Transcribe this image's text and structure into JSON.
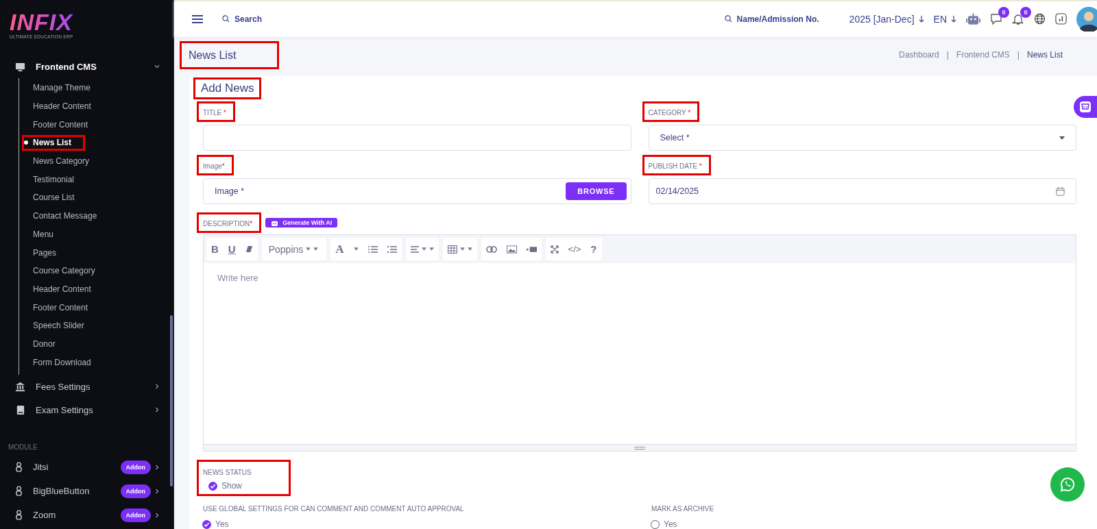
{
  "sidebar": {
    "logo": {
      "text": "INFIX",
      "tagline": "ULTIMATE EDUCATION ERP"
    },
    "menu": [
      {
        "label": "Frontend CMS",
        "expanded": true,
        "children": [
          {
            "label": "Manage Theme",
            "selected": false,
            "highlighted": false
          },
          {
            "label": "Header Content",
            "selected": false,
            "highlighted": false
          },
          {
            "label": "Footer Content",
            "selected": false,
            "highlighted": false
          },
          {
            "label": "News List",
            "selected": true,
            "highlighted": true
          },
          {
            "label": "News Category",
            "selected": false,
            "highlighted": false
          },
          {
            "label": "Testimonial",
            "selected": false,
            "highlighted": false
          },
          {
            "label": "Course List",
            "selected": false,
            "highlighted": false
          },
          {
            "label": "Contact Message",
            "selected": false,
            "highlighted": false
          },
          {
            "label": "Menu",
            "selected": false,
            "highlighted": false
          },
          {
            "label": "Pages",
            "selected": false,
            "highlighted": false
          },
          {
            "label": "Course Category",
            "selected": false,
            "highlighted": false
          },
          {
            "label": "Header Content",
            "selected": false,
            "highlighted": false
          },
          {
            "label": "Footer Content",
            "selected": false,
            "highlighted": false
          },
          {
            "label": "Speech Slider",
            "selected": false,
            "highlighted": false
          },
          {
            "label": "Donor",
            "selected": false,
            "highlighted": false
          },
          {
            "label": "Form Download",
            "selected": false,
            "highlighted": false
          }
        ]
      },
      {
        "label": "Fees Settings",
        "expanded": false
      },
      {
        "label": "Exam Settings",
        "expanded": false
      }
    ],
    "section_label": "MODULE",
    "modules": [
      {
        "label": "Jitsi",
        "badge": "Addon"
      },
      {
        "label": "BigBlueButton",
        "badge": "Addon"
      },
      {
        "label": "Zoom",
        "badge": "Addon"
      }
    ]
  },
  "topbar": {
    "search": {
      "placeholder": "Search"
    },
    "student_search": {
      "placeholder": "Name/Admission No."
    },
    "session": "2025 [Jan-Dec]",
    "language": "EN",
    "message_count": "0",
    "notification_count": "0"
  },
  "page_title": {
    "text": "News List",
    "highlighted": true
  },
  "breadcrumb": {
    "separator": "|",
    "items": [
      "Dashboard",
      "Frontend CMS",
      "News List"
    ]
  },
  "form": {
    "heading": {
      "text": "Add News",
      "highlighted": true
    },
    "title": {
      "label": "TITLE",
      "required_mark": "*",
      "highlighted": true
    },
    "category": {
      "label": "CATEGORY",
      "required_mark": "*",
      "highlighted": true,
      "placeholder": "Select *"
    },
    "image": {
      "label": "Image",
      "required_mark": "*",
      "highlighted": true,
      "placeholder": "Image *",
      "button": "BROWSE"
    },
    "publish_date": {
      "label": "PUBLISH DATE",
      "required_mark": "*",
      "highlighted": true,
      "value": "02/14/2025"
    },
    "description": {
      "label": "DESCRIPTION",
      "required_mark": "*",
      "highlighted": true,
      "ai_button": "Generate With AI"
    },
    "editor": {
      "bold": "B",
      "underline": "U",
      "font": "Poppins",
      "font_color_button": "A",
      "code": "</>",
      "help": "?",
      "placeholder": "Write here"
    },
    "news_status": {
      "label": "NEWS STATUS",
      "highlighted": true,
      "options": [
        {
          "label": "Show",
          "checked": true
        }
      ]
    },
    "comment_settings": {
      "label": "USE GLOBAL SETTINGS FOR CAN COMMENT AND COMMENT AUTO APPROVAL",
      "highlighted": false,
      "options": [
        {
          "label": "Yes",
          "checked": true
        }
      ]
    },
    "archive": {
      "label": "MARK AS ARCHIVE",
      "highlighted": false,
      "options": [
        {
          "label": "Yes",
          "checked": false
        }
      ]
    }
  }
}
